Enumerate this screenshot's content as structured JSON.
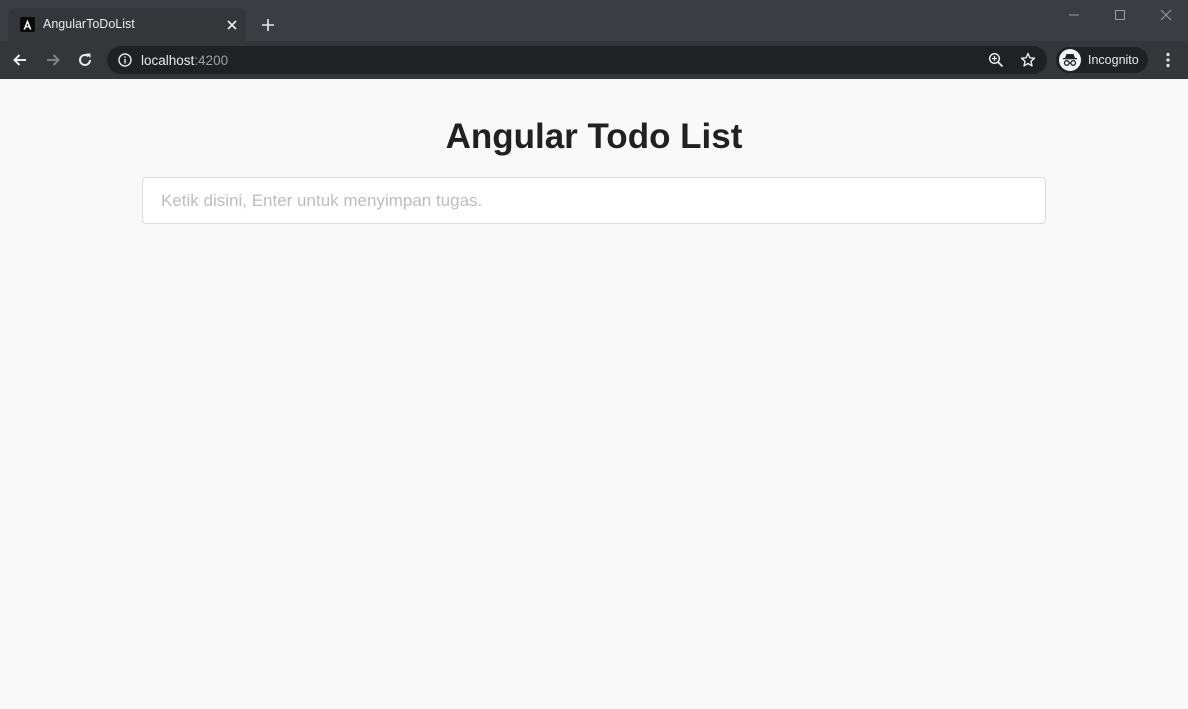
{
  "browser": {
    "tab": {
      "title": "AngularToDoList",
      "favicon": "angular-logo"
    },
    "address_bar": {
      "host": "localhost",
      "port": ":4200"
    },
    "profile": {
      "label": "Incognito"
    }
  },
  "app": {
    "title": "Angular Todo List",
    "input": {
      "value": "",
      "placeholder": "Ketik disini, Enter untuk menyimpan tugas."
    }
  },
  "colors": {
    "tabstrip_bg": "#3a3d41",
    "toolbar_bg": "#35363a",
    "omnibox_bg": "#202124",
    "page_bg": "#f9f9f9",
    "title_text": "#212121",
    "placeholder_text": "#bdbdbd"
  },
  "icons": {
    "tab_favicon": "angular-icon",
    "tab_close": "close-icon",
    "new_tab": "plus-icon",
    "back": "arrow-left-icon",
    "forward": "arrow-right-icon",
    "reload": "reload-icon",
    "site_info": "info-icon",
    "zoom": "zoom-icon",
    "bookmark": "star-icon",
    "incognito": "incognito-icon",
    "menu": "kebab-menu-icon"
  }
}
